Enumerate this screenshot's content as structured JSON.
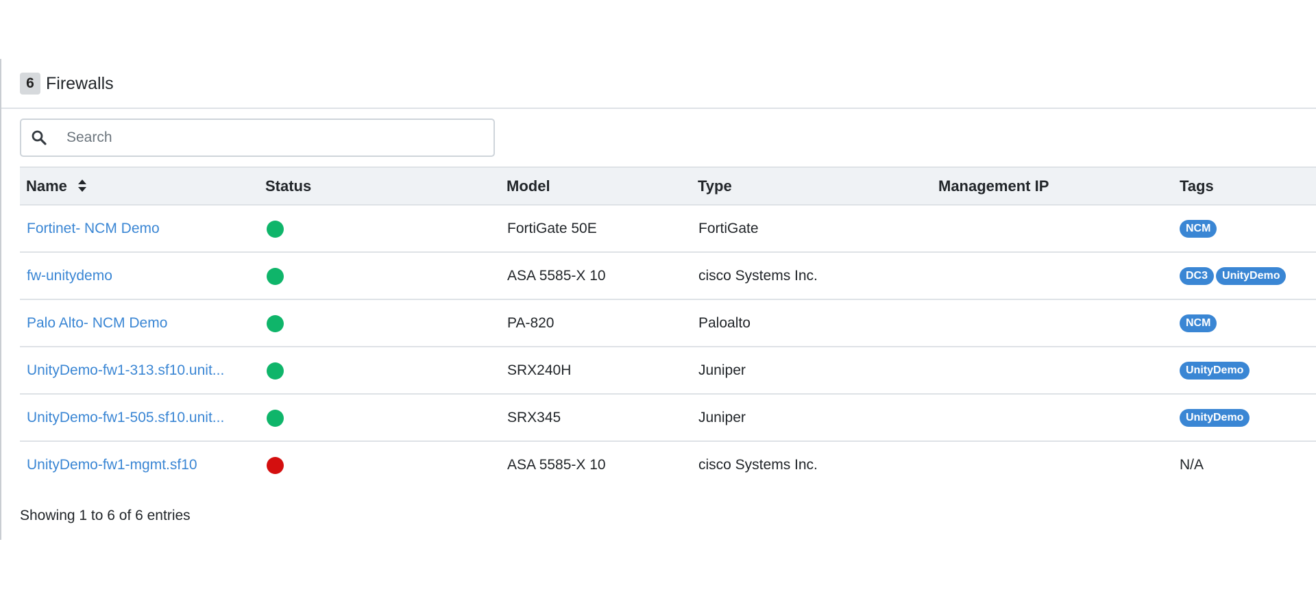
{
  "panel": {
    "count": "6",
    "title": "Firewalls"
  },
  "search": {
    "placeholder": "Search",
    "value": "",
    "icon": "search-icon"
  },
  "table": {
    "columns": {
      "name": "Name",
      "status": "Status",
      "model": "Model",
      "type": "Type",
      "management_ip": "Management IP",
      "tags": "Tags"
    },
    "rows": [
      {
        "name": "Fortinet- NCM Demo",
        "status": "up",
        "model": "FortiGate 50E",
        "type": "FortiGate",
        "management_ip": "",
        "tags": [
          "NCM"
        ],
        "tags_text": ""
      },
      {
        "name": "fw-unitydemo",
        "status": "up",
        "model": "ASA 5585-X 10",
        "type": "cisco Systems Inc.",
        "management_ip": "",
        "tags": [
          "DC3",
          "UnityDemo"
        ],
        "tags_text": ""
      },
      {
        "name": "Palo Alto- NCM Demo",
        "status": "up",
        "model": "PA-820",
        "type": "Paloalto",
        "management_ip": "",
        "tags": [
          "NCM"
        ],
        "tags_text": ""
      },
      {
        "name": "UnityDemo-fw1-313.sf10.unit...",
        "status": "up",
        "model": "SRX240H",
        "type": "Juniper",
        "management_ip": "",
        "tags": [
          "UnityDemo"
        ],
        "tags_text": ""
      },
      {
        "name": "UnityDemo-fw1-505.sf10.unit...",
        "status": "up",
        "model": "SRX345",
        "type": "Juniper",
        "management_ip": "",
        "tags": [
          "UnityDemo"
        ],
        "tags_text": ""
      },
      {
        "name": "UnityDemo-fw1-mgmt.sf10",
        "status": "down",
        "model": "ASA 5585-X 10",
        "type": "cisco Systems Inc.",
        "management_ip": "",
        "tags": [],
        "tags_text": "N/A"
      }
    ]
  },
  "footer": {
    "info": "Showing 1 to 6 of 6 entries"
  },
  "colors": {
    "status_up": "#0fb56a",
    "status_down": "#d40f0f",
    "link": "#3a86d4",
    "tag_bg": "#3a86d4",
    "header_bg": "#eff2f5"
  }
}
